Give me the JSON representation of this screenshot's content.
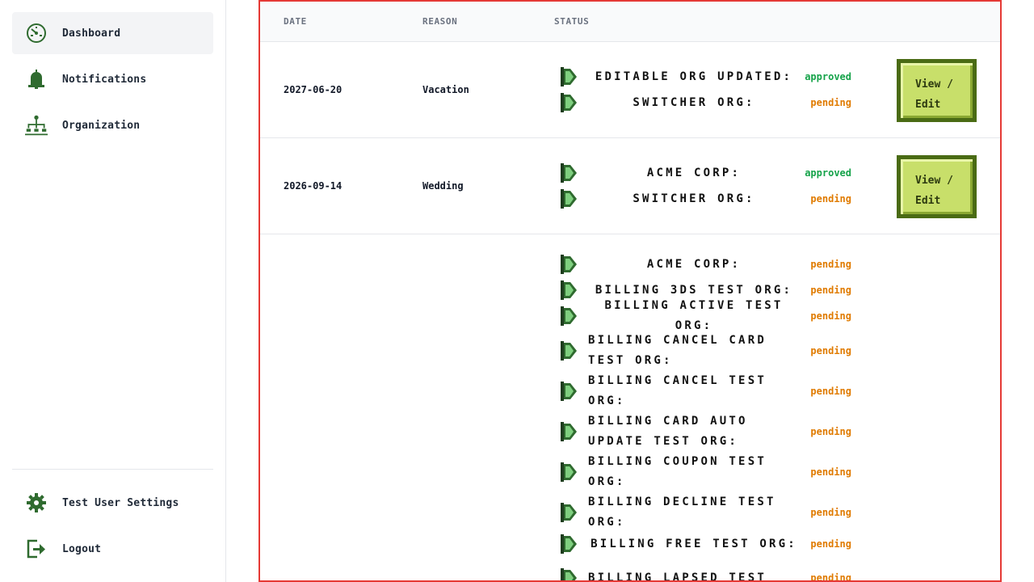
{
  "sidebar": {
    "items": [
      {
        "label": "Dashboard",
        "icon": "dashboard-icon",
        "active": true
      },
      {
        "label": "Notifications",
        "icon": "bell-icon"
      },
      {
        "label": "Organization",
        "icon": "org-chart-icon"
      }
    ],
    "bottom": [
      {
        "label": "Test User Settings",
        "icon": "gear-icon"
      },
      {
        "label": "Logout",
        "icon": "logout-icon"
      }
    ]
  },
  "table": {
    "headers": {
      "date": "DATE",
      "reason": "REASON",
      "status": "STATUS"
    },
    "button_label": "View / Edit",
    "rows": [
      {
        "date": "2027-06-20",
        "reason": "Vacation",
        "statuses": [
          {
            "org": "Editable Org Updated:",
            "status": "approved"
          },
          {
            "org": "Switcher Org:",
            "status": "pending"
          }
        ]
      },
      {
        "date": "2026-09-14",
        "reason": "Wedding",
        "statuses": [
          {
            "org": "Acme Corp:",
            "status": "approved"
          },
          {
            "org": "Switcher Org:",
            "status": "pending"
          }
        ]
      },
      {
        "date": "",
        "reason": "",
        "statuses": [
          {
            "org": "Acme Corp:",
            "status": "pending"
          },
          {
            "org": "Billing 3DS Test Org:",
            "status": "pending"
          },
          {
            "org": "Billing Active Test Org:",
            "status": "pending"
          },
          {
            "org": "Billing Cancel Card Test Org:",
            "status": "pending"
          },
          {
            "org": "Billing Cancel Test Org:",
            "status": "pending"
          },
          {
            "org": "Billing Card Auto Update Test Org:",
            "status": "pending"
          },
          {
            "org": "Billing Coupon Test Org:",
            "status": "pending"
          },
          {
            "org": "Billing Decline Test Org:",
            "status": "pending"
          },
          {
            "org": "Billing Free Test Org:",
            "status": "pending"
          },
          {
            "org": "Billing Lapsed Test",
            "status": "pending"
          }
        ]
      }
    ]
  },
  "colors": {
    "approved": "#16a34a",
    "pending": "#e07b00",
    "accent_green": "#2f6b2f",
    "button_fill": "#c8df6a",
    "button_border": "#4a6b14",
    "table_border": "#e53935"
  }
}
